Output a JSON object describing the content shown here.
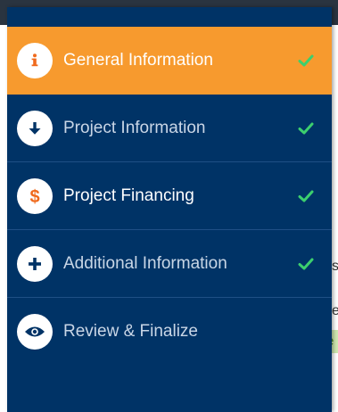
{
  "colors": {
    "sidebar_bg": "#003366",
    "active_bg": "#f79a2e",
    "check_green": "#3ccf6e",
    "icon_orange": "#f06a1d",
    "icon_navy": "#003366"
  },
  "nav": {
    "items": [
      {
        "label": "General Information",
        "icon": "info-icon",
        "completed": true,
        "active": true
      },
      {
        "label": "Project Information",
        "icon": "arrow-down-icon",
        "completed": true,
        "active": false
      },
      {
        "label": "Project Financing",
        "icon": "dollar-icon",
        "completed": true,
        "active": false
      },
      {
        "label": "Additional Information",
        "icon": "plus-icon",
        "completed": true,
        "active": false
      },
      {
        "label": "Review & Finalize",
        "icon": "eye-icon",
        "completed": false,
        "active": false
      }
    ]
  }
}
